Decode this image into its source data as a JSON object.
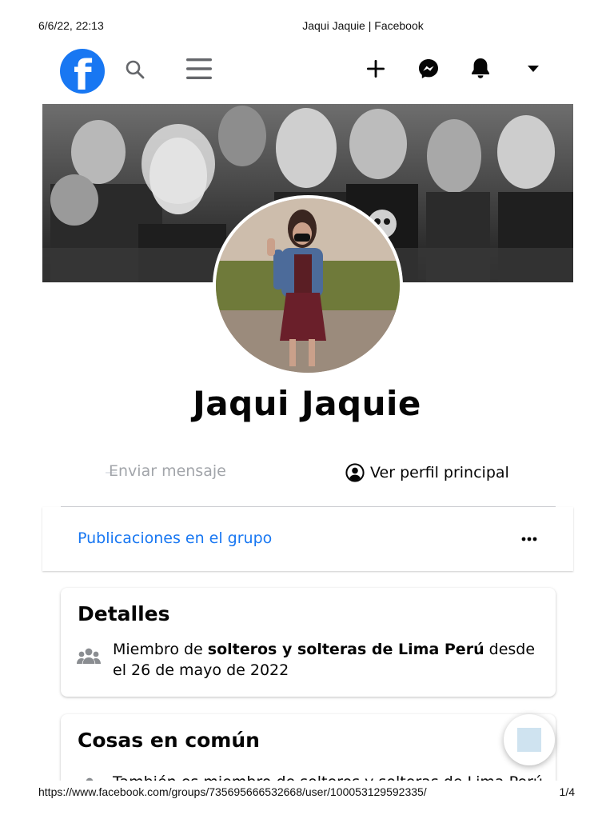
{
  "print": {
    "datetime": "6/6/22, 22:13",
    "title": "Jaqui Jaquie | Facebook",
    "url": "https://www.facebook.com/groups/735695666532668/user/100053129592335/",
    "page": "1/4"
  },
  "nav": {
    "logo_letter": "f",
    "icons": [
      "facebook-logo-icon",
      "search-icon",
      "menu-icon",
      "plus-icon",
      "messenger-icon",
      "bell-icon",
      "caret-down-icon"
    ],
    "brand_color": "#1877f2"
  },
  "profile": {
    "name": "Jaqui Jaquie"
  },
  "actions": {
    "message_label": "Enviar mensaje",
    "main_profile_label": "Ver perfil principal"
  },
  "tabs": {
    "group_posts_label": "Publicaciones en el grupo"
  },
  "details": {
    "title": "Detalles",
    "member_prefix": "Miembro de ",
    "group_name": "solteros y solteras de Lima Perú",
    "member_suffix": " desde el 26 de mayo de 2022"
  },
  "common": {
    "title": "Cosas en común",
    "row_text": "También es miembro de solteros y solteras de Lima Perú"
  },
  "colors": {
    "link": "#1877f2",
    "text": "#050505",
    "muted": "#a2a5aa"
  }
}
